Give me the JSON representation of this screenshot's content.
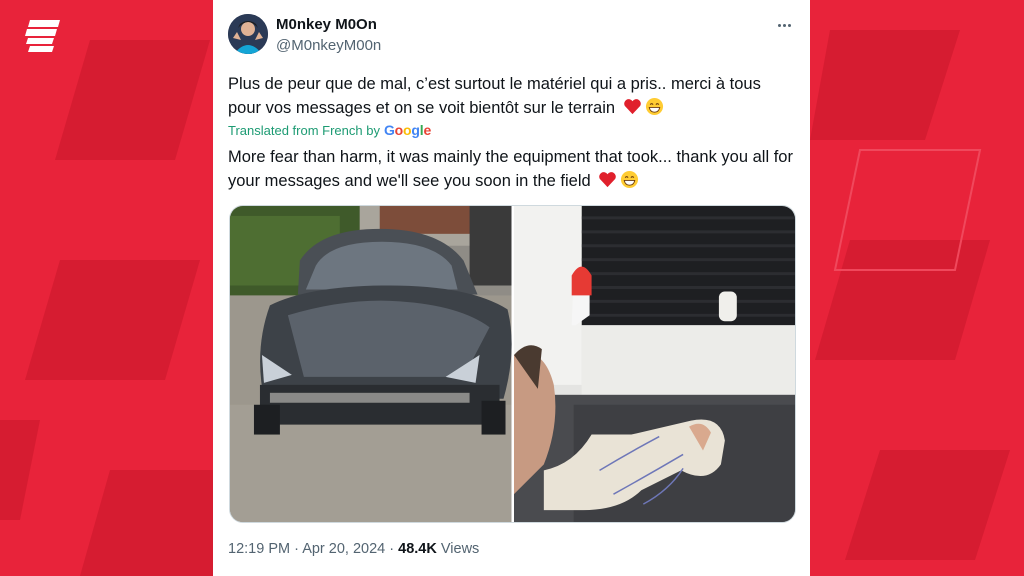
{
  "tweet": {
    "display_name": "M0nkey M0On",
    "handle": "@M0nkeyM00n",
    "text": "Plus de peur que de mal, c’est surtout le matériel qui a pris.. merci à tous pour vos messages et on se voit bientôt sur le terrain",
    "translated_label": "Translated from French by",
    "translation_provider": "Google",
    "translation": "More fear than harm, it was mainly the equipment that took... thank you all for your messages and we'll see you soon in the field",
    "time": "12:19 PM",
    "separator": "·",
    "date": "Apr 20, 2024",
    "views_count": "48.4K",
    "views_label": "Views",
    "emojis": [
      "red-heart-emoji",
      "grinning-face-emoji"
    ],
    "media": [
      {
        "name": "damaged-car-photo"
      },
      {
        "name": "bandaged-hand-photo"
      }
    ]
  },
  "colors": {
    "background": "#e8233a",
    "card": "#ffffff",
    "text_primary": "#0f1419",
    "text_secondary": "#536471",
    "translated_label": "#1d9b73"
  },
  "icons": [
    "brand-logo-icon",
    "more-options-icon"
  ]
}
